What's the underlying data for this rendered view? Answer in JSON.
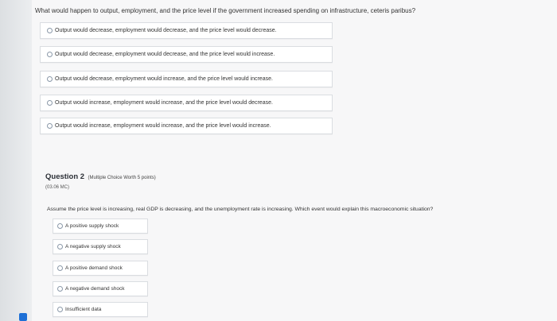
{
  "question1": {
    "text": "What would happen to output, employment, and the price level if the government increased spending on infrastructure, ceteris paribus?",
    "options": [
      "Output would decrease, employment would decrease, and the price level would decrease.",
      "Output would decrease, employment would decrease, and the price level would increase.",
      "Output would decrease, employment would increase, and the price level would increase.",
      "Output would increase, employment would increase, and the price level would decrease.",
      "Output would increase, employment would increase, and the price level would increase."
    ]
  },
  "question2": {
    "title": "Question 2",
    "meta": "(Multiple Choice Worth 5 points)",
    "code": "(03.06 MC)",
    "text": "Assume the price level is increasing, real GDP is decreasing, and the unemployment rate is increasing. Which event would explain this macroeconomic situation?",
    "options": [
      "A positive supply shock",
      "A negative supply shock",
      "A positive demand shock",
      "A negative demand shock",
      "Insufficient data"
    ]
  }
}
